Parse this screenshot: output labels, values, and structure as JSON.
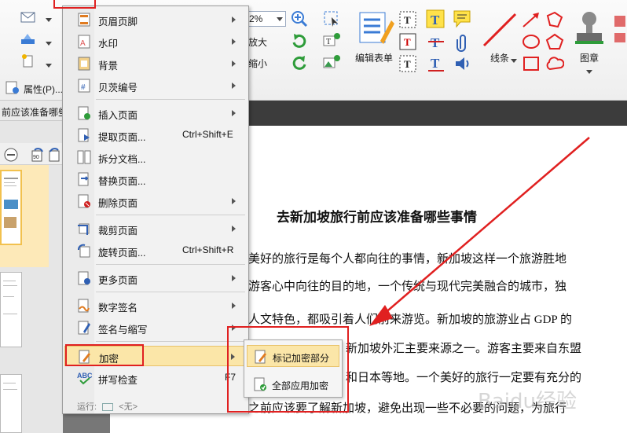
{
  "ribbon": {
    "properties_label": "属性(P)...",
    "zoom_value": "2%",
    "zoom_in_label": "放大",
    "zoom_out_label": "缩小",
    "edit_form_label": "编辑表单",
    "lines_label": "线条",
    "stamp_label": "图章"
  },
  "doc_tab": {
    "title": "前应该准备哪些"
  },
  "context_menu": {
    "items": [
      {
        "label": "页眉页脚",
        "shortcut": "",
        "submenu": true
      },
      {
        "label": "水印",
        "shortcut": "",
        "submenu": true
      },
      {
        "label": "背景",
        "shortcut": "",
        "submenu": true
      },
      {
        "label": "贝茨编号",
        "shortcut": "",
        "submenu": true
      },
      {
        "label": "插入页面",
        "shortcut": "",
        "submenu": true
      },
      {
        "label": "提取页面...",
        "shortcut": "Ctrl+Shift+E",
        "submenu": false
      },
      {
        "label": "拆分文档...",
        "shortcut": "",
        "submenu": false
      },
      {
        "label": "替换页面...",
        "shortcut": "",
        "submenu": false
      },
      {
        "label": "删除页面",
        "shortcut": "",
        "submenu": true
      },
      {
        "label": "裁剪页面",
        "shortcut": "",
        "submenu": true
      },
      {
        "label": "旋转页面...",
        "shortcut": "Ctrl+Shift+R",
        "submenu": false
      },
      {
        "label": "更多页面",
        "shortcut": "",
        "submenu": true
      },
      {
        "label": "数字签名",
        "shortcut": "",
        "submenu": true
      },
      {
        "label": "签名与缩写",
        "shortcut": "",
        "submenu": true
      },
      {
        "label": "加密",
        "shortcut": "",
        "submenu": true
      },
      {
        "label": "拼写检查",
        "shortcut": "F7",
        "submenu": false
      }
    ],
    "run_label": "运行:",
    "run_value": "<无>"
  },
  "encrypt_submenu": {
    "items": [
      {
        "label": "标记加密部分"
      },
      {
        "label": "全部应用加密"
      }
    ]
  },
  "document": {
    "title": "去新加坡旅行前应该准备哪些事情",
    "lines": [
      "美好的旅行是每个人都向往的事情，新加坡这样一个旅游胜地",
      "游客心中向往的目的地，一个传统与现代完美融合的城市，独",
      "人文特色，都吸引着人们前来游览。新加坡的旅游业占 GDP 的",
      "新加坡外汇主要来源之一。游客主要来自东盟",
      "和日本等地。一个美好的旅行一定要有充分的",
      "之前应该要了解新加坡，避免出现一些不必要的问题，为旅行"
    ],
    "watermark": "Baidu经验"
  },
  "colors": {
    "highlight": "#fbe6a8",
    "annotation_red": "#e02020",
    "menu_bg": "#f2f2f2"
  }
}
